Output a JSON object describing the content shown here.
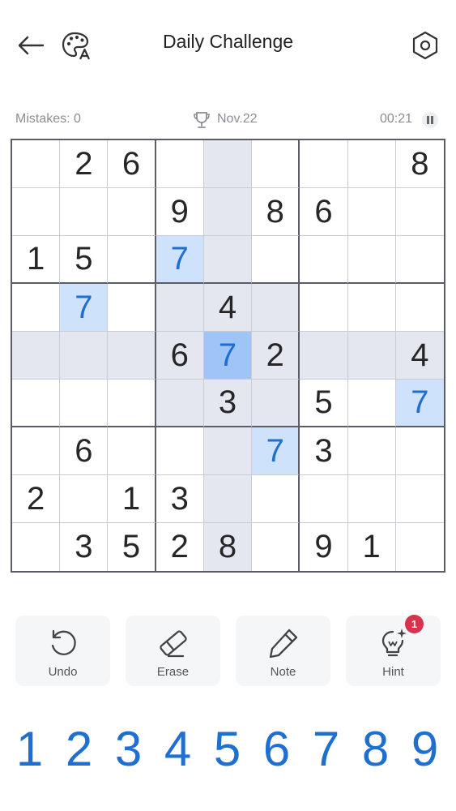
{
  "header": {
    "title": "Daily Challenge"
  },
  "status": {
    "mistakes": "Mistakes: 0",
    "date": "Nov.22",
    "timer": "00:21"
  },
  "board": {
    "values": [
      [
        "",
        "2",
        "6",
        "",
        "",
        "",
        "",
        "",
        "8"
      ],
      [
        "",
        "",
        "",
        "9",
        "",
        "8",
        "6",
        "",
        ""
      ],
      [
        "1",
        "5",
        "",
        "7",
        "",
        "",
        "",
        "",
        ""
      ],
      [
        "",
        "7",
        "",
        "",
        "4",
        "",
        "",
        "",
        ""
      ],
      [
        "",
        "",
        "",
        "6",
        "7",
        "2",
        "",
        "",
        "4"
      ],
      [
        "",
        "",
        "",
        "",
        "3",
        "",
        "5",
        "",
        "7"
      ],
      [
        "",
        "6",
        "",
        "",
        "",
        "7",
        "3",
        "",
        ""
      ],
      [
        "2",
        "",
        "1",
        "3",
        "",
        "",
        "",
        "",
        ""
      ],
      [
        "",
        "3",
        "5",
        "2",
        "8",
        "",
        "9",
        "1",
        ""
      ]
    ],
    "user_entered": [
      [
        2,
        3
      ],
      [
        3,
        1
      ],
      [
        4,
        4
      ],
      [
        5,
        8
      ],
      [
        6,
        5
      ]
    ],
    "selected": [
      4,
      4
    ],
    "selected_value": "7"
  },
  "tools": [
    {
      "label": "Undo",
      "icon": "undo-icon"
    },
    {
      "label": "Erase",
      "icon": "eraser-icon"
    },
    {
      "label": "Note",
      "icon": "pencil-icon"
    },
    {
      "label": "Hint",
      "icon": "lightbulb-icon"
    }
  ],
  "hint_badge": "1",
  "numpad": [
    "1",
    "2",
    "3",
    "4",
    "5",
    "6",
    "7",
    "8",
    "9"
  ],
  "colors": {
    "accent": "#1f6fd1",
    "highlight": "#e4e6f0",
    "same_value": "#cfe2fb",
    "selected": "#9fc4f6",
    "badge": "#d6344e"
  }
}
